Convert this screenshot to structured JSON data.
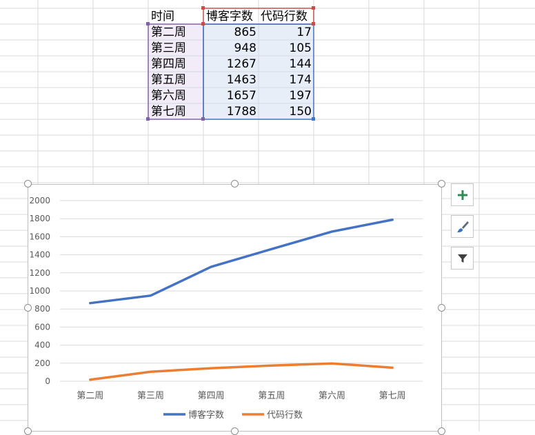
{
  "table": {
    "headers": [
      "时间",
      "博客字数",
      "代码行数"
    ],
    "rows": [
      {
        "period": "第二周",
        "blog_words": "865",
        "code_lines": "17"
      },
      {
        "period": "第三周",
        "blog_words": "948",
        "code_lines": "105"
      },
      {
        "period": "第四周",
        "blog_words": "1267",
        "code_lines": "144"
      },
      {
        "period": "第五周",
        "blog_words": "1463",
        "code_lines": "174"
      },
      {
        "period": "第六周",
        "blog_words": "1657",
        "code_lines": "197"
      },
      {
        "period": "第七周",
        "blog_words": "1788",
        "code_lines": "150"
      }
    ]
  },
  "chart_data": {
    "type": "line",
    "categories": [
      "第二周",
      "第三周",
      "第四周",
      "第五周",
      "第六周",
      "第七周"
    ],
    "series": [
      {
        "name": "博客字数",
        "values": [
          865,
          948,
          1267,
          1463,
          1657,
          1788
        ],
        "color": "#4472c4"
      },
      {
        "name": "代码行数",
        "values": [
          17,
          105,
          144,
          174,
          197,
          150
        ],
        "color": "#ed7d31"
      }
    ],
    "yticks": [
      0,
      200,
      400,
      600,
      800,
      1000,
      1200,
      1400,
      1600,
      1800,
      2000
    ],
    "ylim": [
      0,
      2000
    ],
    "grid": true,
    "legend_position": "bottom"
  },
  "chart_tools": {
    "add_element": "chart-elements-button",
    "style": "chart-styles-button",
    "filter": "chart-filters-button"
  },
  "colors": {
    "grid": "#d9d9d9",
    "header_border": "#c0504d",
    "category_border": "#8064a2",
    "values_border": "#4472c4",
    "category_fill": "#f1ecf8",
    "values_fill": "#e8eef8"
  }
}
